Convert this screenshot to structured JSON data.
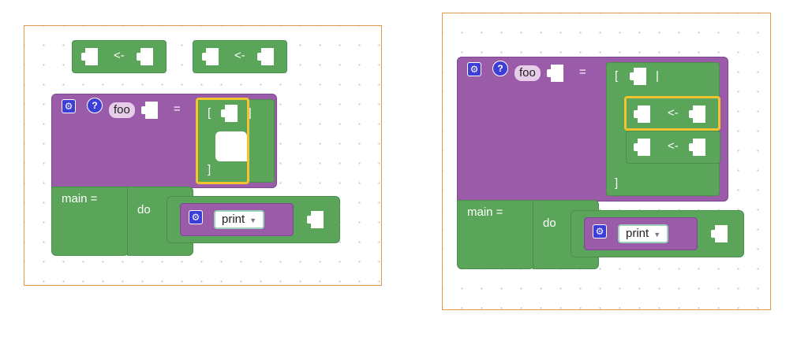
{
  "assign_op": "<-",
  "func": {
    "name": "foo",
    "eq": "="
  },
  "list": {
    "open": "[",
    "bar": "|",
    "close": "]"
  },
  "main": {
    "label": "main =",
    "do": "do"
  },
  "print": {
    "label": "print",
    "arrow": "▼"
  },
  "icons": {
    "gear": "gear-icon",
    "help": "help-icon"
  },
  "colors": {
    "function_block": "#9a5ba8",
    "green_block": "#5ba55b",
    "highlight": "#f4c430",
    "panel_border": "#e29a4a",
    "icon_blue": "#3d3dd8"
  }
}
